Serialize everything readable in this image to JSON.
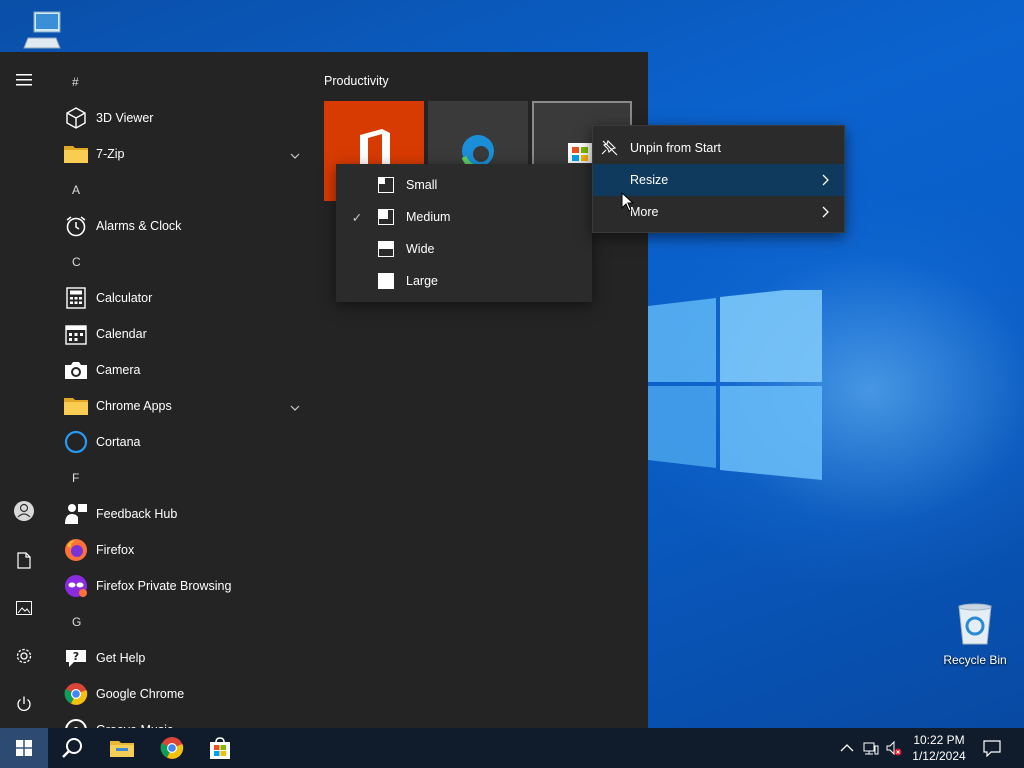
{
  "desktop": {
    "icons": [
      {
        "label": "",
        "icon": "this-pc-icon"
      },
      {
        "label": "Recycle Bin",
        "icon": "recycle-bin-icon"
      }
    ]
  },
  "start_menu": {
    "rail": [
      "hamburger-menu-icon",
      "user-account-icon",
      "documents-icon",
      "pictures-icon",
      "settings-icon",
      "power-icon"
    ],
    "app_list": [
      {
        "type": "letter",
        "text": "#"
      },
      {
        "type": "app",
        "text": "3D Viewer",
        "icon": "3d-viewer-icon"
      },
      {
        "type": "app",
        "text": "7-Zip",
        "icon": "folder-icon",
        "expandable": true
      },
      {
        "type": "letter",
        "text": "A"
      },
      {
        "type": "app",
        "text": "Alarms & Clock",
        "icon": "alarm-clock-icon"
      },
      {
        "type": "letter",
        "text": "C"
      },
      {
        "type": "app",
        "text": "Calculator",
        "icon": "calculator-icon"
      },
      {
        "type": "app",
        "text": "Calendar",
        "icon": "calendar-icon"
      },
      {
        "type": "app",
        "text": "Camera",
        "icon": "camera-icon"
      },
      {
        "type": "app",
        "text": "Chrome Apps",
        "icon": "folder-icon",
        "expandable": true
      },
      {
        "type": "app",
        "text": "Cortana",
        "icon": "cortana-icon"
      },
      {
        "type": "letter",
        "text": "F"
      },
      {
        "type": "app",
        "text": "Feedback Hub",
        "icon": "feedback-hub-icon"
      },
      {
        "type": "app",
        "text": "Firefox",
        "icon": "firefox-icon"
      },
      {
        "type": "app",
        "text": "Firefox Private Browsing",
        "icon": "firefox-private-icon"
      },
      {
        "type": "letter",
        "text": "G"
      },
      {
        "type": "app",
        "text": "Get Help",
        "icon": "get-help-icon"
      },
      {
        "type": "app",
        "text": "Google Chrome",
        "icon": "chrome-icon"
      },
      {
        "type": "app",
        "text": "Groove Music",
        "icon": "groove-music-icon"
      }
    ],
    "group_title": "Productivity",
    "tiles": [
      {
        "name": "office-tile",
        "color": "#d83b01"
      },
      {
        "name": "edge-tile",
        "color": "#3a3a3a"
      },
      {
        "name": "store-tile",
        "color": "#3a3a3a"
      }
    ]
  },
  "resize_submenu": {
    "items": [
      {
        "label": "Small",
        "checked": false
      },
      {
        "label": "Medium",
        "checked": true
      },
      {
        "label": "Wide",
        "checked": false
      },
      {
        "label": "Large",
        "checked": false
      }
    ]
  },
  "context_menu": {
    "items": [
      {
        "label": "Unpin from Start",
        "icon": "unpin-icon",
        "submenu": false,
        "highlighted": false
      },
      {
        "label": "Resize",
        "icon": "",
        "submenu": true,
        "highlighted": true
      },
      {
        "label": "More",
        "icon": "",
        "submenu": true,
        "highlighted": false
      }
    ]
  },
  "taskbar": {
    "pinned": [
      "windows-start-icon",
      "search-icon",
      "file-explorer-icon",
      "chrome-icon",
      "microsoft-store-icon"
    ],
    "tray": [
      "chevron-up-icon",
      "network-icon",
      "volume-muted-icon"
    ],
    "time": "10:22 PM",
    "date": "1/12/2024",
    "notification_icon": "action-center-icon"
  },
  "colors": {
    "accent": "#0078d7",
    "start_bg": "#242424",
    "menu_bg": "#2b2b2b",
    "highlight": "#0f3a5e",
    "taskbar_bg": "#101c2c"
  }
}
